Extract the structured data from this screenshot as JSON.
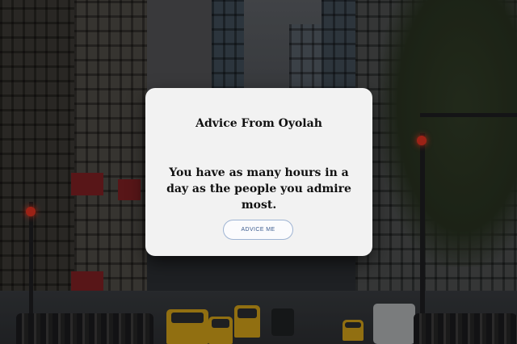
{
  "card": {
    "title": "Advice From Oyolah",
    "advice": "You have as many hours in a day as the people you admire most.",
    "button_label": "ADVICE ME"
  },
  "colors": {
    "card_background": "#f2f2f2",
    "button_border": "#9fb4d3",
    "button_text": "#3b5b8e"
  }
}
